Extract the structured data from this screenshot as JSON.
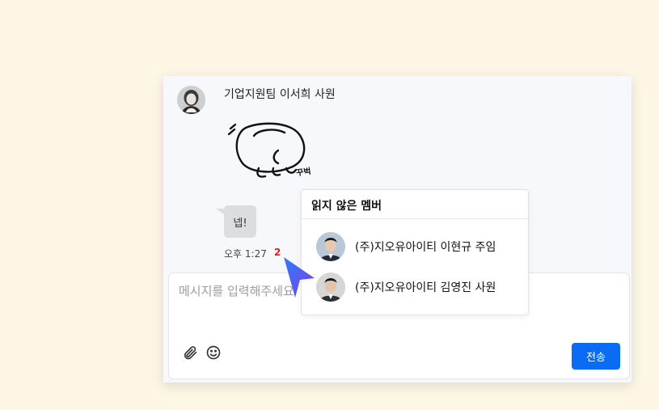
{
  "message": {
    "sender_name": "기업지원팀 이서희 사원",
    "text": "넵!",
    "time": "오후 1:27",
    "unread_count": "2",
    "sticker_caption": "꾸벅"
  },
  "composer": {
    "placeholder": "메시지를 입력해주세요",
    "send_label": "전송",
    "attach_icon": "paperclip-icon",
    "emoji_icon": "smiley-icon"
  },
  "unread_popover": {
    "title": "읽지 않은 멤버",
    "members": [
      {
        "name": "(주)지오유아이티 이현규 주임"
      },
      {
        "name": "(주)지오유아이티 김영진 사원"
      }
    ]
  },
  "colors": {
    "page_background": "#fdf6e4",
    "send_button": "#0a6cf5",
    "unread_count": "#e02020",
    "cursor": "#4a63e8"
  }
}
